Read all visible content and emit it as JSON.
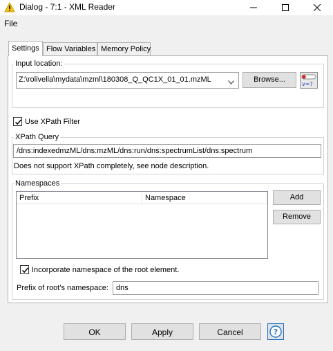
{
  "window": {
    "title": "Dialog - 7:1 - XML Reader",
    "app_icon": "warning-triangle-icon",
    "controls": [
      "minimize-icon",
      "maximize-icon",
      "close-icon"
    ]
  },
  "menu": {
    "file": "File"
  },
  "tabs": [
    {
      "label": "Settings",
      "active": true
    },
    {
      "label": "Flow Variables",
      "active": false
    },
    {
      "label": "Memory Policy",
      "active": false
    }
  ],
  "input_location": {
    "legend": "Input location:",
    "value": "Z:\\rolivella\\mydata\\mzml\\180308_Q_QC1X_01_01.mzML",
    "browse_label": "Browse...",
    "flow_variable_icon": "flow-variable-icon"
  },
  "xpath_filter": {
    "label": "Use XPath Filter",
    "checked": true
  },
  "xpath_query": {
    "legend": "XPath Query",
    "value": "/dns:indexedmzML/dns:mzML/dns:run/dns:spectrumList/dns:spectrum",
    "note": "Does not support XPath completely, see node description."
  },
  "namespaces": {
    "legend": "Namespaces",
    "columns": [
      "Prefix",
      "Namespace"
    ],
    "rows": [],
    "add_label": "Add",
    "remove_label": "Remove",
    "incorporate_label": "Incorporate namespace of the root element.",
    "incorporate_checked": true,
    "prefix_label": "Prefix of root's namespace:",
    "prefix_value": "dns"
  },
  "buttons": {
    "ok": "OK",
    "apply": "Apply",
    "cancel": "Cancel",
    "help_icon": "help-icon"
  },
  "colors": {
    "accent": "#1a73c8",
    "warning": "#f5c518"
  }
}
